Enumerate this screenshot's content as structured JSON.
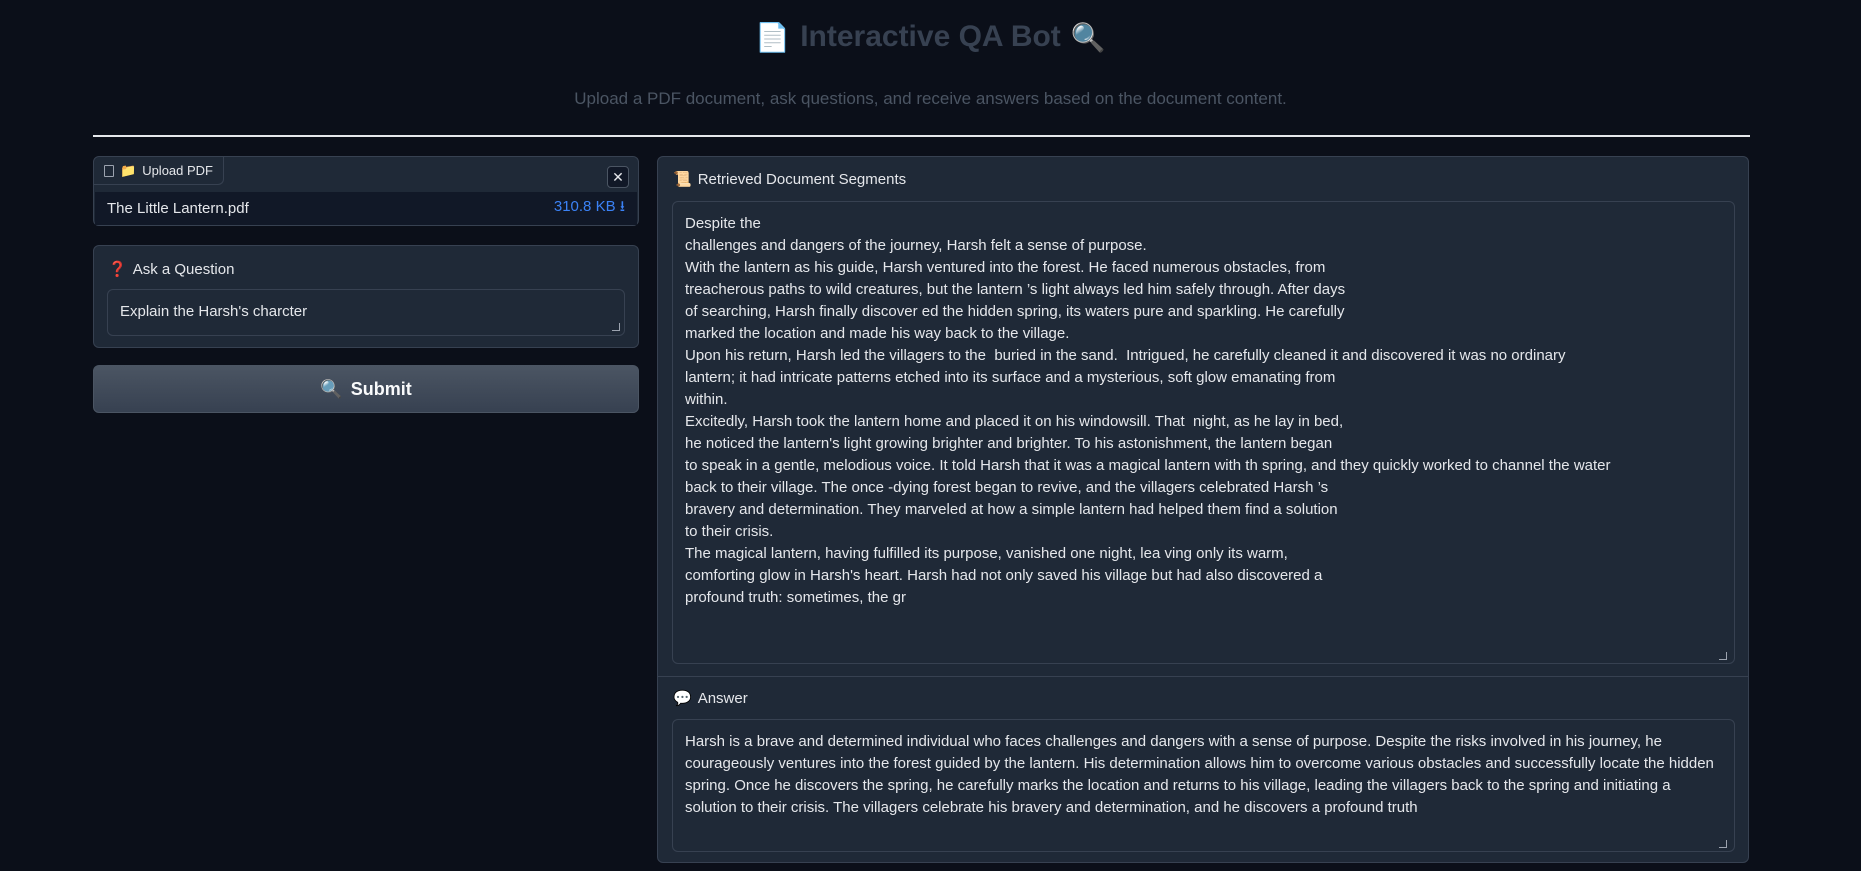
{
  "header": {
    "title": "Interactive QA Bot",
    "title_icon_left": "📄",
    "title_icon_right": "🔍",
    "subtitle": "Upload a PDF document, ask questions, and receive answers based on the document content."
  },
  "upload": {
    "label": "Upload PDF",
    "label_icon": "📁",
    "file_name": "The Little Lantern.pdf",
    "file_size": "310.8 KB ⭳",
    "close_glyph": "✕"
  },
  "question": {
    "label": "Ask a Question",
    "label_icon": "❓",
    "value": "Explain the Harsh's charcter"
  },
  "submit": {
    "label": "Submit",
    "icon": "🔍"
  },
  "segments": {
    "label": "Retrieved Document Segments",
    "label_icon": "📜",
    "text": "Despite the\nchallenges and dangers of the journey, Harsh felt a sense of purpose.\nWith the lantern as his guide, Harsh ventured into the forest. He faced numerous obstacles, from\ntreacherous paths to wild creatures, but the lantern ’s light always led him safely through. After days\nof searching, Harsh finally discover ed the hidden spring, its waters pure and sparkling. He carefully\nmarked the location and made his way back to the village.\nUpon his return, Harsh led the villagers to the  buried in the sand.  Intrigued, he carefully cleaned it and discovered it was no ordinary\nlantern; it had intricate patterns etched into its surface and a mysterious, soft glow emanating from\nwithin.\nExcitedly, Harsh took the lantern home and placed it on his windowsill. That  night, as he lay in bed,\nhe noticed the lantern's light growing brighter and brighter. To his astonishment, the lantern began\nto speak in a gentle, melodious voice. It told Harsh that it was a magical lantern with th spring, and they quickly worked to channel the water\nback to their village. The once -dying forest began to revive, and the villagers celebrated Harsh ’s\nbravery and determination. They marveled at how a simple lantern had helped them find a solution\nto their crisis.\nThe magical lantern, having fulfilled its purpose, vanished one night, lea ving only its warm,\ncomforting glow in Harsh's heart. Harsh had not only saved his village but had also discovered a\nprofound truth: sometimes, the gr"
  },
  "answer": {
    "label": "Answer",
    "label_icon": "💬",
    "text": "Harsh is a brave and determined individual who faces challenges and dangers with a sense of purpose. Despite the risks involved in his journey, he courageously ventures into the forest guided by the lantern. His determination allows him to overcome various obstacles and successfully locate the hidden spring. Once he discovers the spring, he carefully marks the location and returns to his village, leading the villagers back to the spring and initiating a solution to their crisis. The villagers celebrate his bravery and determination, and he discovers a profound truth"
  }
}
